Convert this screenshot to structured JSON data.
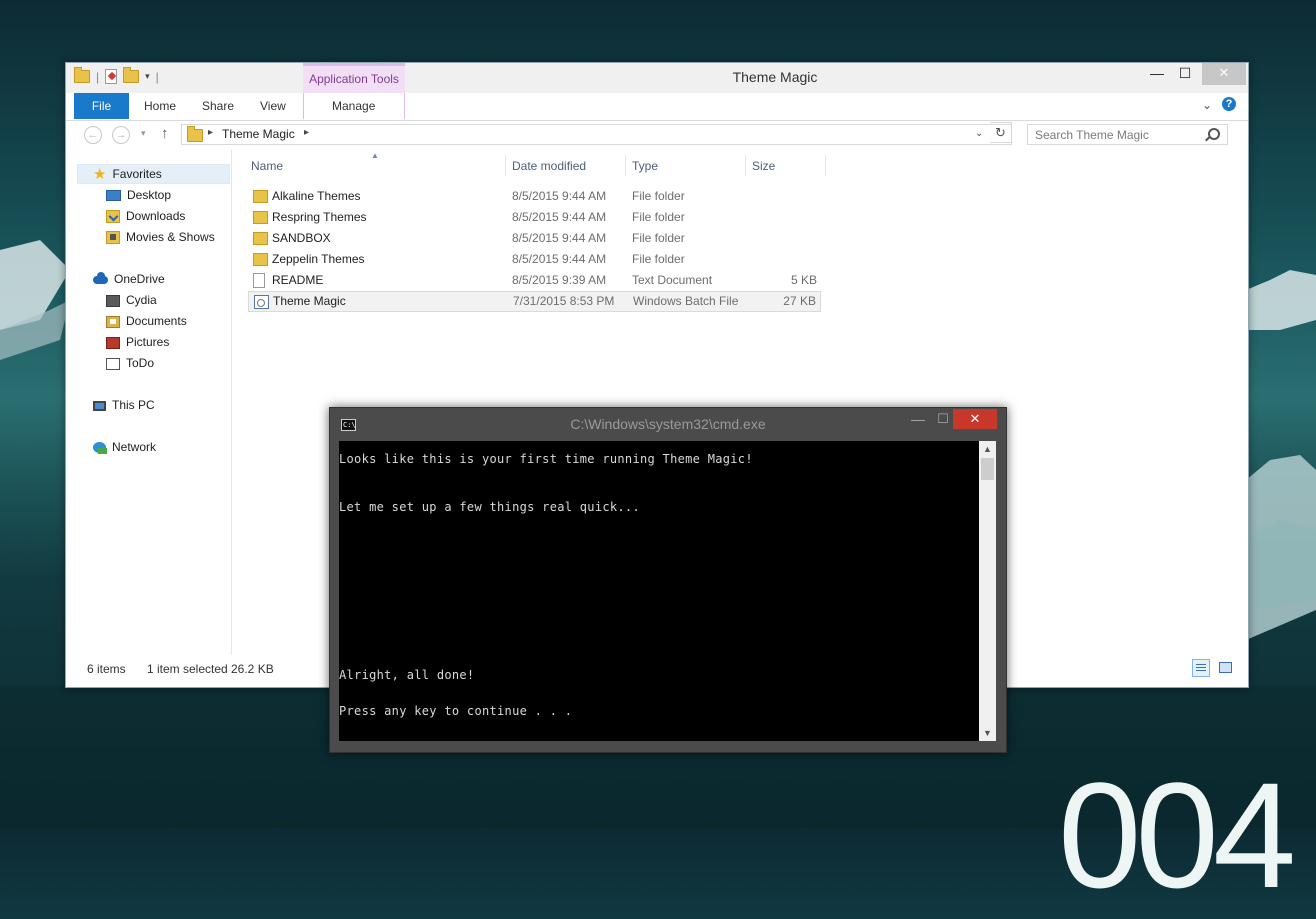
{
  "explorer": {
    "title": "Theme Magic",
    "contextual_tab": "Application Tools",
    "tabs": {
      "file": "File",
      "home": "Home",
      "share": "Share",
      "view": "View",
      "manage": "Manage"
    },
    "controls": {
      "minimize": "—",
      "maximize": "☐",
      "close": "✕"
    },
    "address": {
      "path": "Theme Magic"
    },
    "search_placeholder": "Search Theme Magic",
    "navpane": {
      "favorites": "Favorites",
      "desktop": "Desktop",
      "downloads": "Downloads",
      "movies": "Movies & Shows",
      "onedrive": "OneDrive",
      "cydia": "Cydia",
      "documents": "Documents",
      "pictures": "Pictures",
      "todo": "ToDo",
      "thispc": "This PC",
      "network": "Network"
    },
    "columns": {
      "name": "Name",
      "date": "Date modified",
      "type": "Type",
      "size": "Size"
    },
    "files": [
      {
        "name": "Alkaline Themes",
        "date": "8/5/2015 9:44 AM",
        "type": "File folder",
        "size": ""
      },
      {
        "name": "Respring Themes",
        "date": "8/5/2015 9:44 AM",
        "type": "File folder",
        "size": ""
      },
      {
        "name": "SANDBOX",
        "date": "8/5/2015 9:44 AM",
        "type": "File folder",
        "size": ""
      },
      {
        "name": "Zeppelin Themes",
        "date": "8/5/2015 9:44 AM",
        "type": "File folder",
        "size": ""
      },
      {
        "name": "README",
        "date": "8/5/2015 9:39 AM",
        "type": "Text Document",
        "size": "5 KB"
      },
      {
        "name": "Theme Magic",
        "date": "7/31/2015 8:53 PM",
        "type": "Windows Batch File",
        "size": "27 KB"
      }
    ],
    "status": {
      "count": "6 items",
      "selected": "1 item selected",
      "size": "26.2 KB"
    }
  },
  "cmd": {
    "title": "C:\\Windows\\system32\\cmd.exe",
    "icon_label": "C:\\",
    "lines": [
      "Looks like this is your first time running Theme Magic!",
      "Let me set up a few things real quick...",
      "Alright, all done!",
      "Press any key to continue . . ."
    ]
  },
  "wallpaper": {
    "text": "004"
  }
}
